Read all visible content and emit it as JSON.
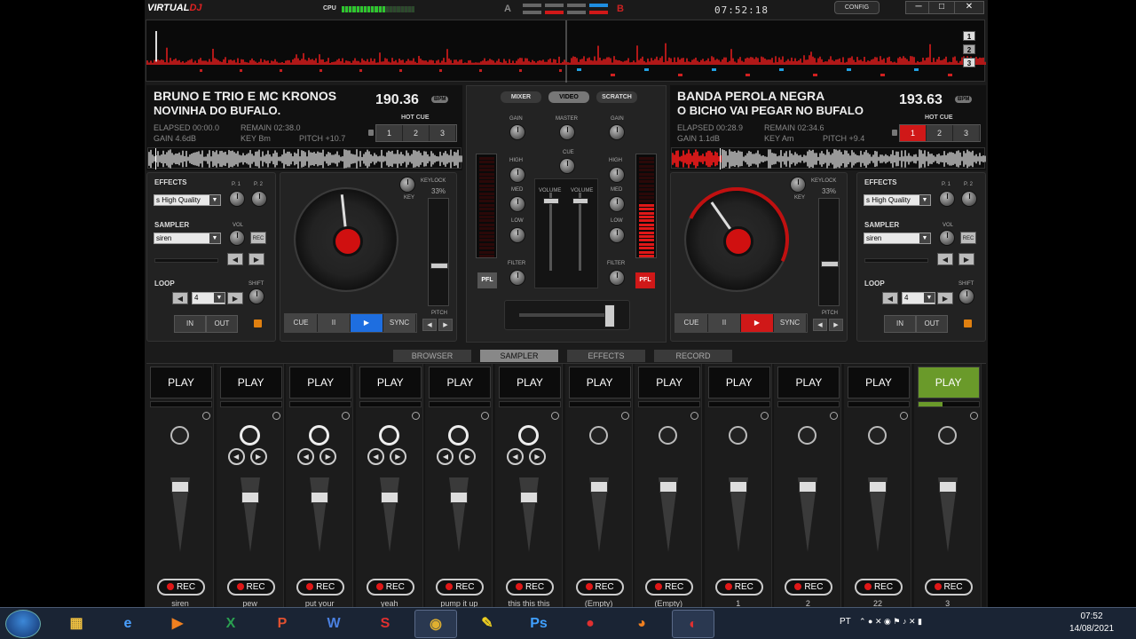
{
  "app": {
    "logo_a": "VIRTUAL",
    "logo_b": "DJ",
    "cpu_label": "CPU",
    "cpu_level": 0.6,
    "side_a": "A",
    "side_b": "B",
    "clock": "07:52:18",
    "config": "CONFIG",
    "win_min": "─",
    "win_max": "□",
    "win_close": "✕",
    "pages": [
      "1",
      "2",
      "3"
    ]
  },
  "deck_left": {
    "artist": "BRUNO E TRIO E MC KRONOS",
    "title": "NOVINHA DO BUFALO.",
    "bpm": "190.36",
    "bpm_label": "BPM",
    "elapsed": "ELAPSED 00:00.0",
    "remain": "REMAIN 02:38.0",
    "gain": "GAIN 4.6dB",
    "key": "KEY Bm",
    "pitch": "PITCH +10.7",
    "hot_cue_label": "HOT CUE",
    "hot_cues": [
      "1",
      "2",
      "3"
    ],
    "keylock": "KEYLOCK",
    "keylock_pct": "33%",
    "key_lbl": "KEY",
    "pitch_lbl": "PITCH",
    "transport": [
      "CUE",
      "II",
      "▶",
      "SYNC"
    ]
  },
  "deck_right": {
    "artist": "BANDA PEROLA NEGRA",
    "title": "O BICHO VAI PEGAR NO BUFALO",
    "bpm": "193.63",
    "bpm_label": "BPM",
    "elapsed": "ELAPSED 00:28.9",
    "remain": "REMAIN 02:34.6",
    "gain": "GAIN 1.1dB",
    "key": "KEY Am",
    "pitch": "PITCH +9.4",
    "hot_cue_label": "HOT CUE",
    "hot_cues": [
      "1",
      "2",
      "3"
    ],
    "keylock": "KEYLOCK",
    "keylock_pct": "33%",
    "key_lbl": "KEY",
    "pitch_lbl": "PITCH",
    "transport": [
      "CUE",
      "II",
      "▶",
      "SYNC"
    ]
  },
  "fx_left": {
    "effects": "EFFECTS",
    "effect_val": "s High Quality",
    "p1": "P. 1",
    "p2": "P. 2",
    "sampler": "SAMPLER",
    "sampler_val": "siren",
    "vol": "VOL",
    "rec": "REC",
    "loop": "LOOP",
    "loop_val": "4",
    "shift": "SHIFT",
    "in": "IN",
    "out": "OUT"
  },
  "fx_right": {
    "effects": "EFFECTS",
    "effect_val": "s High Quality",
    "p1": "P. 1",
    "p2": "P. 2",
    "sampler": "SAMPLER",
    "sampler_val": "siren",
    "vol": "VOL",
    "rec": "REC",
    "loop": "LOOP",
    "loop_val": "4",
    "shift": "SHIFT",
    "in": "IN",
    "out": "OUT"
  },
  "mixer": {
    "tabs": [
      "MIXER",
      "VIDEO",
      "SCRATCH"
    ],
    "gain": "GAIN",
    "master": "MASTER",
    "cue": "CUE",
    "high": "HIGH",
    "med": "MED",
    "low": "LOW",
    "filter": "FILTER",
    "volume": "VOLUME",
    "pfl": "PFL"
  },
  "browser_tabs": [
    "BROWSER",
    "SAMPLER",
    "EFFECTS",
    "RECORD"
  ],
  "sampler": {
    "play": "PLAY",
    "rec": "REC",
    "slots": [
      {
        "name": "siren",
        "progress": 0,
        "big": false,
        "arrows": false
      },
      {
        "name": "pew",
        "progress": 0,
        "big": true,
        "arrows": true
      },
      {
        "name": "put your",
        "progress": 0,
        "big": true,
        "arrows": true
      },
      {
        "name": "yeah",
        "progress": 0,
        "big": true,
        "arrows": true
      },
      {
        "name": "pump it up",
        "progress": 0,
        "big": true,
        "arrows": true
      },
      {
        "name": "this this this",
        "progress": 0,
        "big": true,
        "arrows": true
      },
      {
        "name": "(Empty)",
        "progress": 0,
        "big": false,
        "arrows": false
      },
      {
        "name": "(Empty)",
        "progress": 0,
        "big": false,
        "arrows": false
      },
      {
        "name": "1",
        "progress": 0,
        "big": false,
        "arrows": false
      },
      {
        "name": "2",
        "progress": 0,
        "big": false,
        "arrows": false
      },
      {
        "name": "22",
        "progress": 0,
        "big": false,
        "arrows": false
      },
      {
        "name": "3",
        "progress": 0.4,
        "big": false,
        "arrows": false,
        "active": true
      }
    ]
  },
  "taskbar": {
    "lang": "PT",
    "time": "07:52",
    "date": "14/08/2021"
  }
}
